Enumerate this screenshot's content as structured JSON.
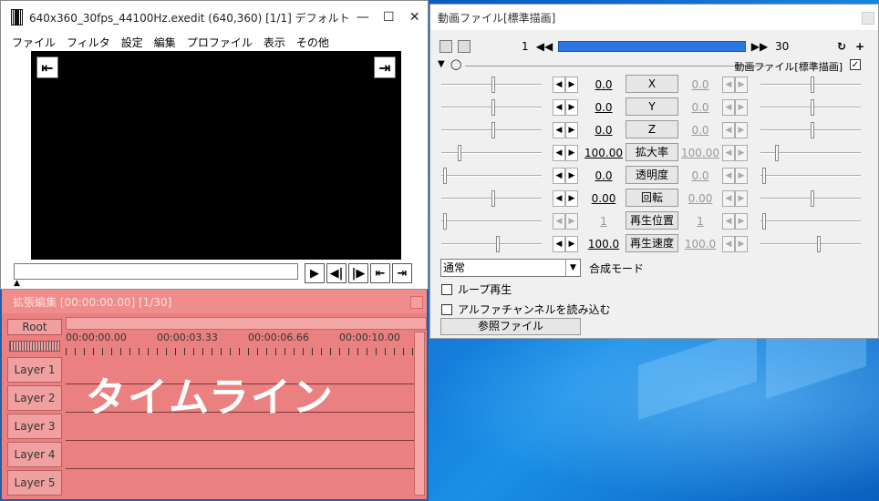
{
  "main_window": {
    "title": "640x360_30fps_44100Hz.exedit (640,360)  [1/1]  デフォルト",
    "menu": [
      "ファイル",
      "フィルタ",
      "設定",
      "編集",
      "プロファイル",
      "表示",
      "その他"
    ]
  },
  "timeline": {
    "title": "拡張編集 [00:00:00.00] [1/30]",
    "root_label": "Root",
    "ruler": [
      "00:00:00.00",
      "00:00:03.33",
      "00:00:06.66",
      "00:00:10.00"
    ],
    "layers": [
      "Layer 1",
      "Layer 2",
      "Layer 3",
      "Layer 4",
      "Layer 5"
    ],
    "overlay_label": "タイムライン"
  },
  "settings_window": {
    "title": "動画ファイル[標準描画]",
    "frame_start": "1",
    "frame_end": "30",
    "object_label": "動画ファイル[標準描画]",
    "params": [
      {
        "name": "X",
        "left": "0.0",
        "right": "0.0"
      },
      {
        "name": "Y",
        "left": "0.0",
        "right": "0.0"
      },
      {
        "name": "Z",
        "left": "0.0",
        "right": "0.0"
      },
      {
        "name": "拡大率",
        "left": "100.00",
        "right": "100.00"
      },
      {
        "name": "透明度",
        "left": "0.0",
        "right": "0.0"
      },
      {
        "name": "回転",
        "left": "0.00",
        "right": "0.00"
      },
      {
        "name": "再生位置",
        "left": "1",
        "right": "1"
      },
      {
        "name": "再生速度",
        "left": "100.0",
        "right": "100.0"
      }
    ],
    "blend_mode_value": "通常",
    "blend_mode_label": "合成モード",
    "loop_label": "ループ再生",
    "alpha_label": "アルファチャンネルを読み込む",
    "ref_file_label": "参照ファイル"
  }
}
